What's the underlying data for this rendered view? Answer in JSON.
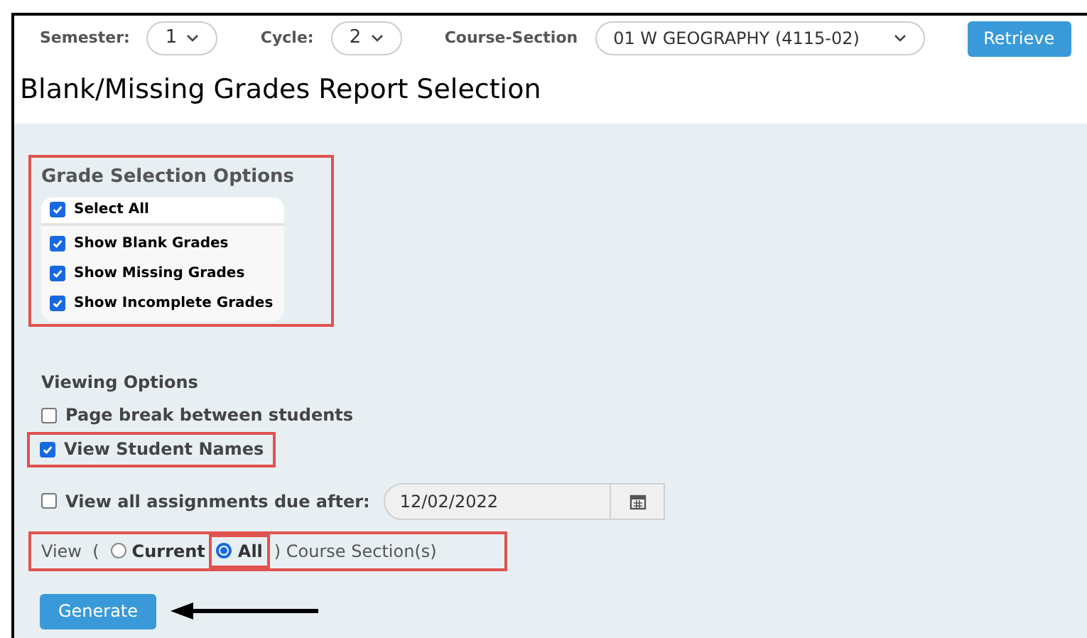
{
  "top_bar": {
    "fields": [
      {
        "label": "Semester:",
        "value": "1",
        "kind": "small"
      },
      {
        "label": "Cycle:",
        "value": "2",
        "kind": "small"
      },
      {
        "label": "Course-Section",
        "value": "01 W GEOGRAPHY (4115-02)",
        "kind": "wide"
      }
    ],
    "button": "Retrieve"
  },
  "title": "Blank/Missing Grades Report Selection",
  "grade_selection": {
    "heading": "Grade Selection Options",
    "highlighted": true,
    "select_all": {
      "label": "Select All",
      "checked": true
    },
    "items": [
      {
        "label": "Show Blank Grades",
        "checked": true
      },
      {
        "label": "Show Missing Grades",
        "checked": true
      },
      {
        "label": "Show Incomplete Grades",
        "checked": true
      }
    ]
  },
  "viewing_options": {
    "heading": "Viewing Options",
    "page_break": {
      "label": "Page break between students",
      "checked": false,
      "highlighted": false
    },
    "student_names": {
      "label": "View Student Names",
      "checked": true,
      "highlighted": true
    },
    "assignments_due": {
      "label": "View all assignments due after:",
      "checked": false,
      "date": "12/02/2022"
    },
    "view_sections": {
      "prefix": "View  (",
      "suffix": ") Course Section(s)",
      "highlighted": true,
      "options": [
        {
          "label": "Current",
          "selected": false,
          "highlighted": false
        },
        {
          "label": "All",
          "selected": true,
          "highlighted": true
        }
      ]
    }
  },
  "generate": {
    "label": "Generate",
    "arrow": true
  }
}
